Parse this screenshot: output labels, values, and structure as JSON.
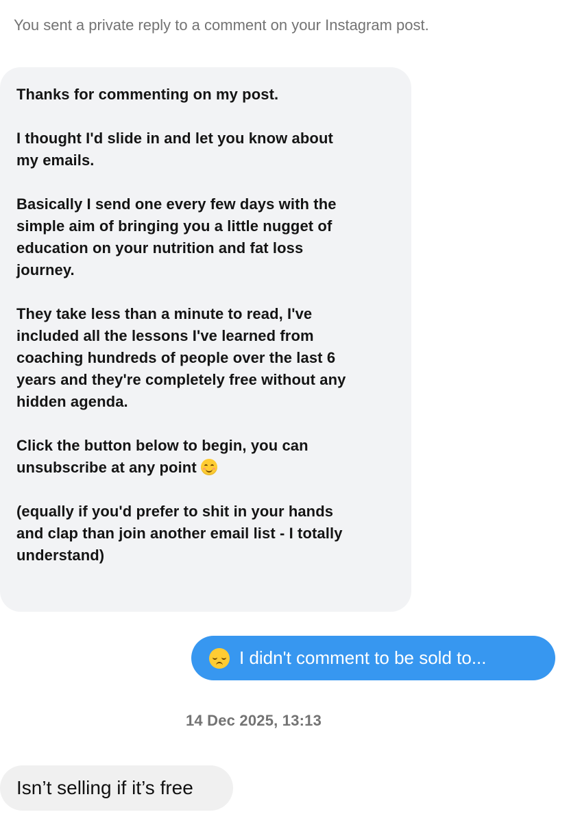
{
  "system_note": "You sent a private reply to a comment on your Instagram post.",
  "messages": {
    "incoming_long": {
      "paragraphs": [
        "Thanks for commenting on my post.",
        "I thought I'd slide in and let you know about\nmy emails.",
        "Basically I send one every few days with the\nsimple aim of bringing you a little nugget of\neducation on your nutrition and fat loss\njourney.",
        "They take less than a minute to read, I've\nincluded all the lessons I've learned from\ncoaching hundreds of people over the last 6\nyears and they're completely free without any\nhidden agenda.",
        "Click the button below to begin, you can\nunsubscribe at any point",
        "(equally if you'd prefer to shit in your hands\nand clap than join another email list - I totally\nunderstand)"
      ],
      "emoji_after_paragraph_5": "smiling-face-icon"
    },
    "outgoing": {
      "emoji": "disappointed-face-icon",
      "text": "I didn't comment to be sold to..."
    },
    "timestamp": "14 Dec 2025, 13:13",
    "incoming_short": {
      "text": "Isn’t selling if it’s free"
    }
  },
  "colors": {
    "outgoing_bubble": "#3797f0",
    "incoming_bubble": "#f2f3f5",
    "meta_text": "#737373"
  }
}
